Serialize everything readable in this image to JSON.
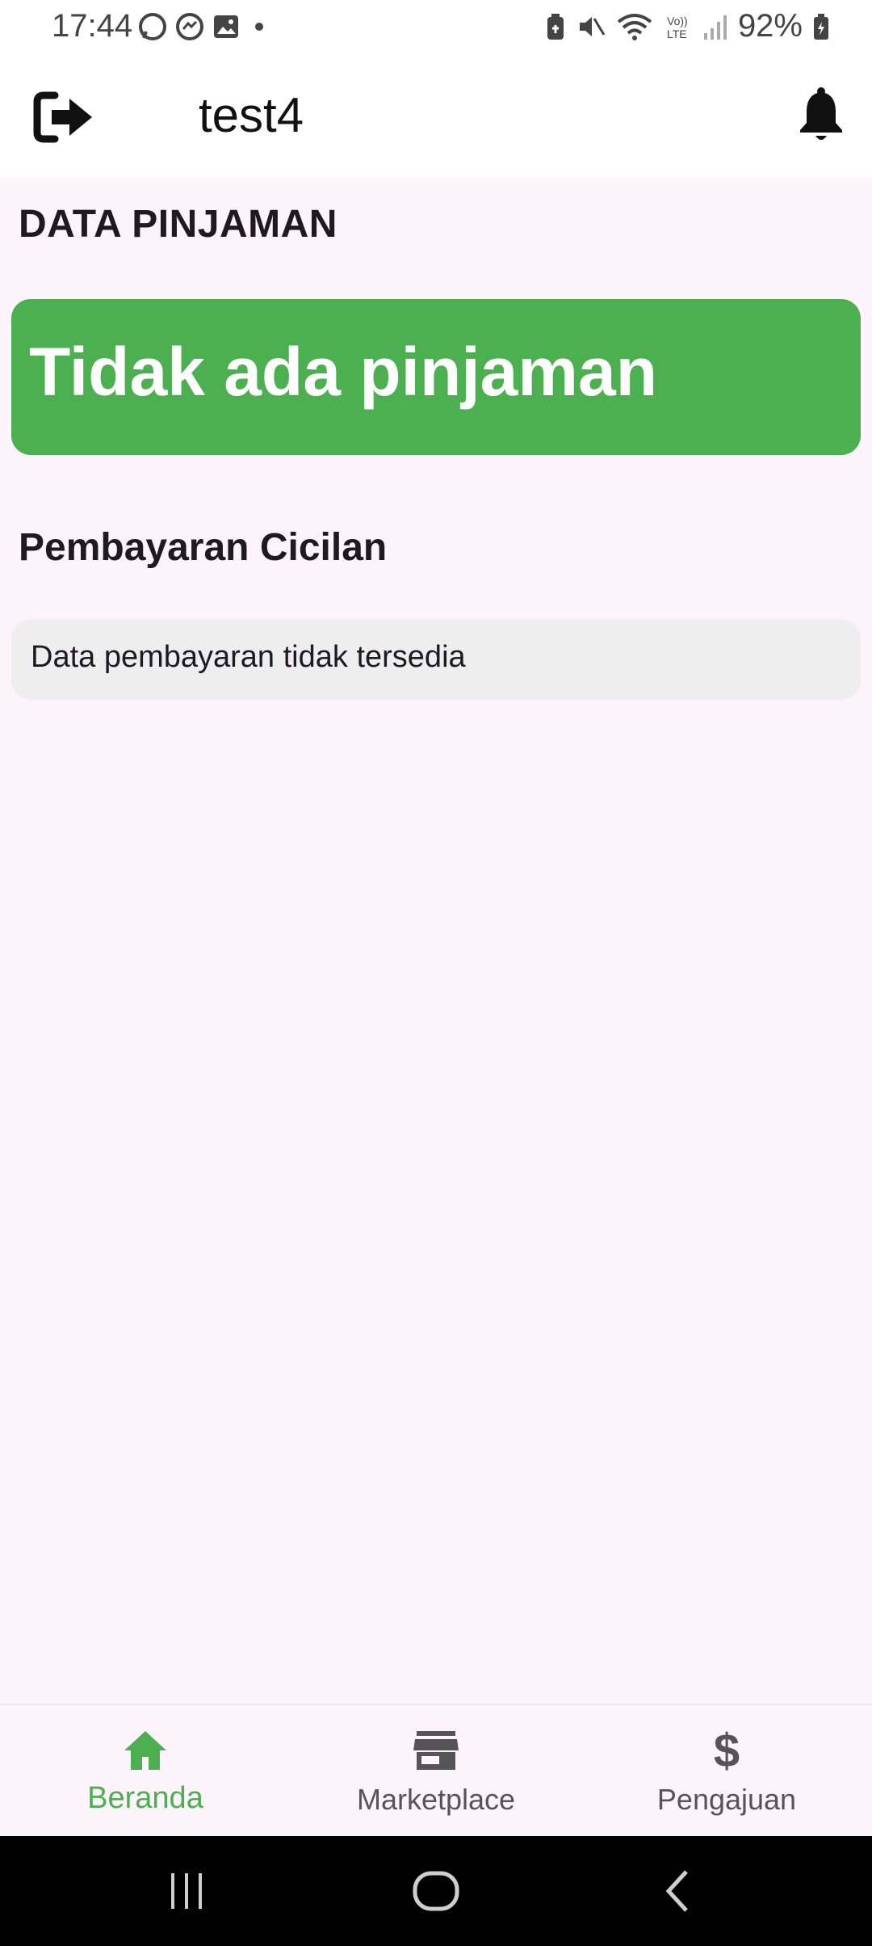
{
  "status_bar": {
    "time": "17:44",
    "battery": "92%",
    "icons": [
      "whatsapp-icon",
      "messenger-icon",
      "gallery-icon",
      "dot-icon",
      "battery-saver-icon",
      "mute-icon",
      "wifi-icon",
      "volte-icon",
      "signal-icon",
      "battery-icon"
    ]
  },
  "app_bar": {
    "title": "test4",
    "left_icon": "logout-icon",
    "right_icon": "bell-icon"
  },
  "loan": {
    "section_title": "DATA PINJAMAN",
    "card_text": "Tidak ada pinjaman",
    "card_color": "#4caf50"
  },
  "installments": {
    "section_title": "Pembayaran Cicilan",
    "empty_text": "Data pembayaran tidak tersedia"
  },
  "bottom_nav": {
    "items": [
      {
        "label": "Beranda",
        "icon": "home-icon",
        "active": true
      },
      {
        "label": "Marketplace",
        "icon": "store-icon",
        "active": false
      },
      {
        "label": "Pengajuan",
        "icon": "dollar-icon",
        "active": false
      }
    ],
    "active_color": "#4caf50"
  },
  "system_nav": {
    "buttons": [
      "recent-apps-icon",
      "home-circle-icon",
      "back-icon"
    ]
  }
}
